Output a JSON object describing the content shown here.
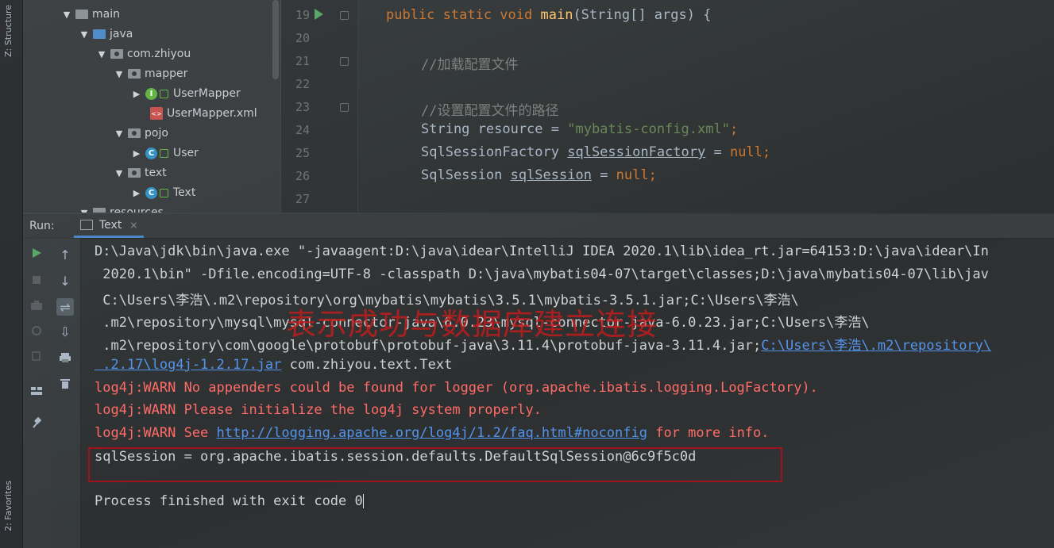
{
  "side_tabs": {
    "structure": "Z: Structure",
    "favorites": "2: Favorites"
  },
  "tree": [
    {
      "label": "main",
      "kind": "folder"
    },
    {
      "label": "java",
      "kind": "folder-src"
    },
    {
      "label": "com.zhiyou",
      "kind": "package"
    },
    {
      "label": "mapper",
      "kind": "package"
    },
    {
      "label": "UserMapper",
      "kind": "interface"
    },
    {
      "label": "UserMapper.xml",
      "kind": "xml"
    },
    {
      "label": "pojo",
      "kind": "package"
    },
    {
      "label": "User",
      "kind": "class"
    },
    {
      "label": "text",
      "kind": "package"
    },
    {
      "label": "Text",
      "kind": "class"
    },
    {
      "label": "resources",
      "kind": "folder"
    }
  ],
  "editor": {
    "line_numbers": [
      "19",
      "20",
      "21",
      "22",
      "23",
      "24",
      "25",
      "26",
      "27"
    ],
    "line19": {
      "kw1": "public static void",
      "fn": "main",
      "rest": "(String[] args) {"
    },
    "line21": "//加载配置文件",
    "line23": "//设置配置文件的路径",
    "line24": {
      "a": "String resource = ",
      "str": "\"mybatis-config.xml\"",
      "semi": ";"
    },
    "line25": {
      "a": "SqlSessionFactory ",
      "var": "sqlSessionFactory",
      "b": " = ",
      "null": "null",
      "semi": ";"
    },
    "line26": {
      "a": "SqlSession ",
      "var": "sqlSession",
      "b": " = ",
      "null": "null",
      "semi": ";"
    }
  },
  "run": {
    "label": "Run:",
    "tab": "Text",
    "close": "×"
  },
  "console": {
    "l1": "D:\\Java\\jdk\\bin\\java.exe \"-javaagent:D:\\java\\idear\\IntelliJ IDEA 2020.1\\lib\\idea_rt.jar=64153:D:\\java\\idear\\In",
    "l2": " 2020.1\\bin\" -Dfile.encoding=UTF-8 -classpath D:\\java\\mybatis04-07\\target\\classes;D:\\java\\mybatis04-07\\lib\\jav",
    "l3": " C:\\Users\\李浩\\.m2\\repository\\org\\mybatis\\mybatis\\3.5.1\\mybatis-3.5.1.jar;C:\\Users\\李浩\\",
    "l4": " .m2\\repository\\mysql\\mysql-connector-java\\6.0.23\\mysql-connector-java-6.0.23.jar;C:\\Users\\李浩\\",
    "l5a": " .m2\\repository\\com\\google\\protobuf\\protobuf-java\\3.11.4\\protobuf-java-3.11.4.jar;",
    "l5link": "C:\\Users\\李浩\\.m2\\repository\\",
    "l6link": " .2.17\\log4j-1.2.17.jar",
    "l6b": " com.zhiyou.text.Text",
    "w1": "log4j:WARN No appenders could be found for logger (org.apache.ibatis.logging.LogFactory).",
    "w2": "log4j:WARN Please initialize the log4j system properly.",
    "w3a": "log4j:WARN See ",
    "w3link": "http://logging.apache.org/log4j/1.2/faq.html#noconfig",
    "w3b": " for more info.",
    "session": "sqlSession = org.apache.ibatis.session.defaults.DefaultSqlSession@6c9f5c0d",
    "exit": "Process finished with exit code 0"
  },
  "annotation": "表示成功与数据库建立连接"
}
